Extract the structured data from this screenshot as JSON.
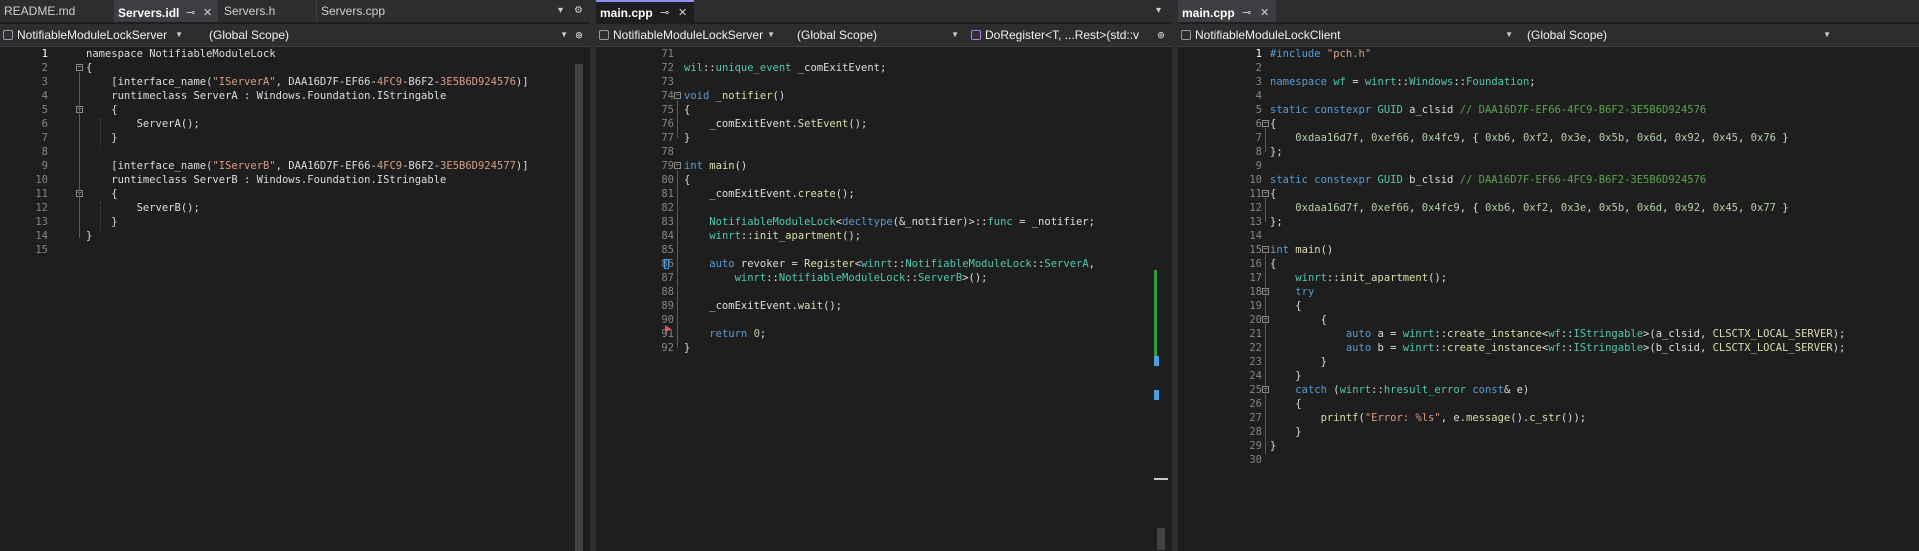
{
  "pane1": {
    "tabs": [
      {
        "label": "README.md",
        "active": false
      },
      {
        "label": "Servers.idl",
        "active": true
      },
      {
        "label": "Servers.h",
        "active": false
      },
      {
        "label": "Servers.cpp",
        "active": false
      }
    ],
    "project": "NotifiableModuleLockServer",
    "scope": "(Global Scope)",
    "current_line": "1"
  },
  "pane2": {
    "tabs": [
      {
        "label": "main.cpp",
        "active": true
      }
    ],
    "project": "NotifiableModuleLockServer",
    "scope": "(Global Scope)",
    "member": "DoRegister<T, ...Rest>(std::v"
  },
  "pane3": {
    "tabs": [
      {
        "label": "main.cpp",
        "active": true
      }
    ],
    "project": "NotifiableModuleLockClient",
    "scope": "(Global Scope)",
    "current_line": "1"
  },
  "icons": {
    "pin": "pin-icon",
    "close": "close-icon",
    "dropdown": "chevron-down-icon",
    "settings": "gear-icon",
    "split": "split-icon"
  },
  "colors": {
    "keyword": "#569cd6",
    "string": "#d69d85",
    "type": "#4ec9b0",
    "number": "#b5cea8",
    "comment": "#57a64a",
    "background": "#1e1e1e"
  }
}
